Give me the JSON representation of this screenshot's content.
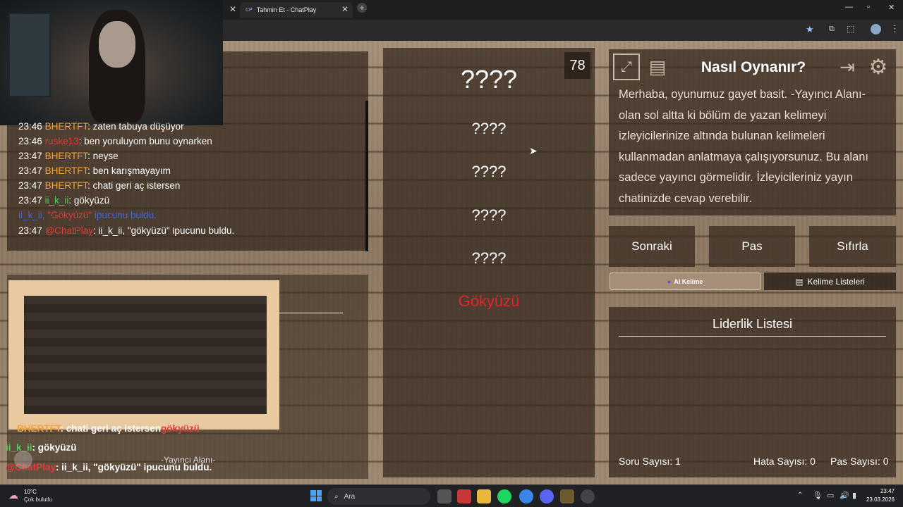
{
  "browser": {
    "tabs": [
      {
        "label": "Tahmin Et - ChatPlay",
        "favicon": "CP"
      }
    ],
    "new_tab_label": "+"
  },
  "chat": {
    "partial_line": {
      "time": "23:46",
      "user": "BHERTFT",
      "text": ": zaten tabuya düşüyor"
    },
    "lines": [
      {
        "time": "23:46",
        "user": "ruske13",
        "text": ": ben yoruluyom bunu oynarken",
        "color": "red"
      },
      {
        "time": "23:47",
        "user": "BHERTFT",
        "text": ": neyse",
        "color": "orange"
      },
      {
        "time": "23:47",
        "user": "BHERTFT",
        "text": ": ben karışmayayım",
        "color": "orange"
      },
      {
        "time": "23:47",
        "user": "BHERTFT",
        "text": ": chati geri aç istersen",
        "color": "orange"
      },
      {
        "time": "23:47",
        "user": "ii_k_ii",
        "text": ": gökyüzü",
        "color": "green"
      }
    ],
    "hint_line": {
      "user": "ii_k_ii,",
      "word": "\"Gökyüzü\"",
      "text": "ipucunu buldu."
    },
    "system_line": {
      "time": "23:47",
      "user": "@ChatPlay",
      "text": ": ii_k_ii, \"gökyüzü\" ipucunu buldu."
    }
  },
  "overlay_chat": {
    "line1": {
      "user": "BHERTFT",
      "text": ": chati geri aç istersen",
      "tail": "gökyüzü"
    },
    "line2": {
      "user": "ii_k_ii",
      "text": ": gökyüzü"
    },
    "line3": {
      "user": "@ChatPlay",
      "text": ": ii_k_ii, \"gökyüzü\" ipucunu buldu."
    },
    "streamer_area_label": "-Yayıncı Alanı-"
  },
  "game": {
    "score": "78",
    "hidden_words": [
      "????",
      "????",
      "????",
      "????",
      "????"
    ],
    "revealed_word": "Gökyüzü",
    "colors": {
      "revealed": "#e0242a"
    }
  },
  "help": {
    "title": "Nasıl Oynanır?",
    "text": "Merhaba, oyunumuz gayet basit. -Yayıncı Alanı- olan sol altta ki bölüm de yazan kelimeyi izleyicilerinize altında bulunan kelimeleri kullanmadan anlatmaya çalışıyorsunuz. Bu alanı sadece yayıncı görmelidir. İzleyicileriniz yayın chatinizde cevap verebilir."
  },
  "actions": {
    "next": "Sonraki",
    "pass": "Pas",
    "reset": "Sıfırla",
    "ai_word": "AI Kelime",
    "word_lists": "Kelime Listeleri"
  },
  "leaderboard": {
    "title": "Liderlik Listesi"
  },
  "stats": {
    "questions_label": "Soru Sayısı:",
    "questions": "1",
    "errors_label": "Hata Sayısı:",
    "errors": "0",
    "passes_label": "Pas Sayısı:",
    "passes": "0"
  },
  "taskbar": {
    "weather_temp": "10°C",
    "weather_desc": "Çok bulutlu",
    "search_placeholder": "Ara",
    "time": "23:47",
    "date": "23.03.2026"
  }
}
